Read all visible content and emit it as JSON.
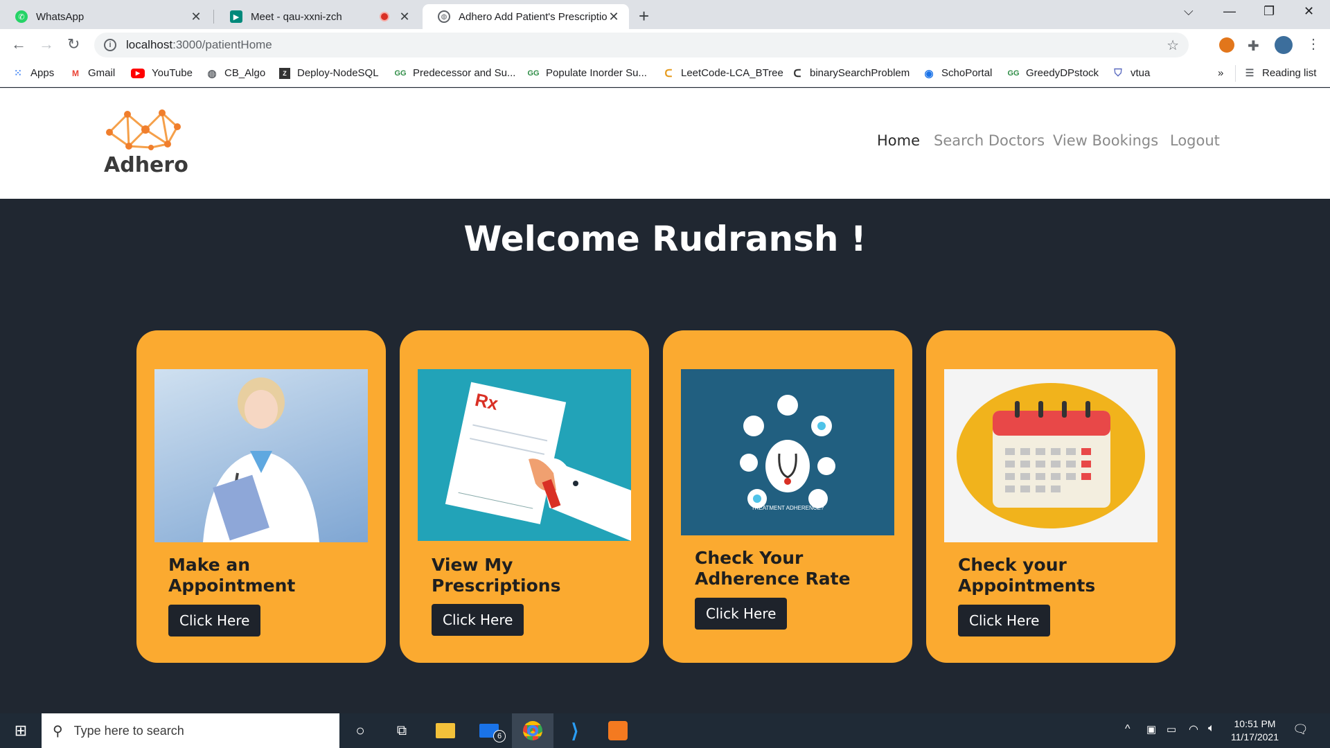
{
  "browser": {
    "tabs": [
      {
        "title": "WhatsApp",
        "icon": "whatsapp-icon",
        "color": "#25d366"
      },
      {
        "title": "Meet - qau-xxni-zch",
        "icon": "meet-icon",
        "color": "#00897b"
      },
      {
        "title": "Adhero Add Patient's Prescription",
        "icon": "globe-icon",
        "color": "#5f6368"
      }
    ],
    "url_host": "localhost",
    "url_path": ":3000/patientHome",
    "bookmarks": [
      {
        "label": "Apps",
        "icon": "apps-grid-icon"
      },
      {
        "label": "Gmail",
        "icon": "gmail-icon"
      },
      {
        "label": "YouTube",
        "icon": "youtube-icon"
      },
      {
        "label": "CB_Algo",
        "icon": "globe-icon"
      },
      {
        "label": "Deploy-NodeSQL",
        "icon": "bookmark-icon"
      },
      {
        "label": "Predecessor and Su...",
        "icon": "gfg-icon"
      },
      {
        "label": "Populate Inorder Su...",
        "icon": "gfg-icon"
      },
      {
        "label": "LeetCode-LCA_BTree",
        "icon": "leetcode-icon"
      },
      {
        "label": "binarySearchProblem",
        "icon": "leetcode-icon"
      },
      {
        "label": "SchoPortal",
        "icon": "globe-icon"
      },
      {
        "label": "GreedyDPstock",
        "icon": "gfg-icon"
      },
      {
        "label": "vtua",
        "icon": "shield-icon"
      }
    ],
    "more": "»",
    "reading_list": "Reading list"
  },
  "site": {
    "logo_text": "Adhero",
    "nav": [
      {
        "label": "Home",
        "active": true
      },
      {
        "label": "Search Doctors",
        "active": false
      },
      {
        "label": "View Bookings",
        "active": false
      },
      {
        "label": "Logout",
        "active": false
      }
    ],
    "welcome": "Welcome Rudransh !",
    "cards": [
      {
        "title": "Make an Appointment",
        "button": "Click Here",
        "image": "doctor-illustration"
      },
      {
        "title": "View My Prescriptions",
        "button": "Click Here",
        "image": "prescription-illustration"
      },
      {
        "title": "Check Your Adherence Rate",
        "button": "Click Here",
        "image": "adherence-illustration",
        "image_caption": "TREATMENT ADHERENCE?"
      },
      {
        "title": "Check your Appointments",
        "button": "Click Here",
        "image": "calendar-illustration"
      }
    ],
    "colors": {
      "background": "#202731",
      "card": "#fbaa30",
      "button": "#1e232b"
    }
  },
  "taskbar": {
    "search_placeholder": "Type here to search",
    "mail_badge": "6",
    "time": "10:51 PM",
    "date": "11/17/2021"
  }
}
